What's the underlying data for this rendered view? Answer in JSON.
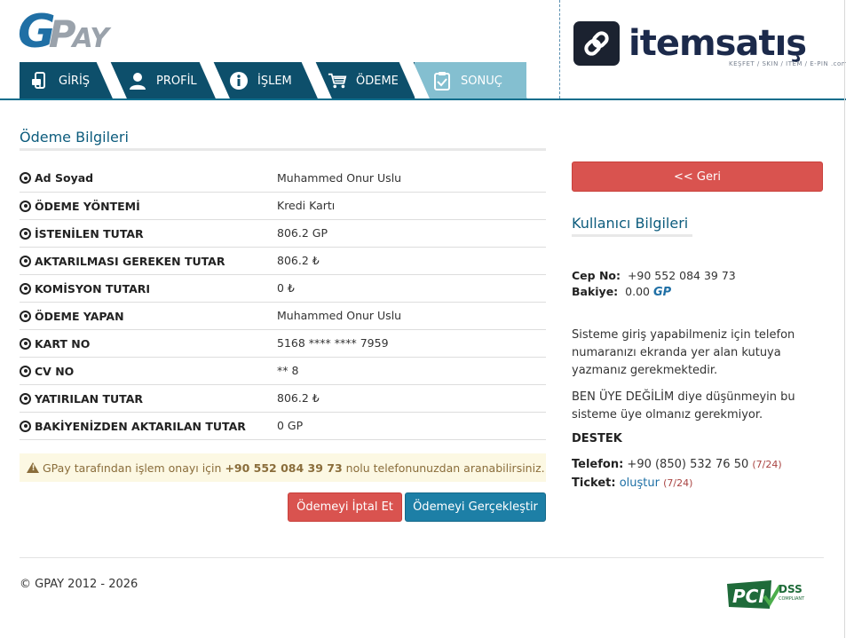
{
  "brand": {
    "logo_text_g": "G",
    "logo_text_p": "P",
    "logo_text_ay": "AY",
    "partner_name": "itemsatış",
    "partner_sub": "KEŞFET / SKIN / ITEM / E-PIN .com"
  },
  "tabs": [
    {
      "label": "GİRİŞ",
      "icon": "phone-card-icon"
    },
    {
      "label": "PROFİL",
      "icon": "user-icon"
    },
    {
      "label": "İŞLEM",
      "icon": "info-icon"
    },
    {
      "label": "ÖDEME",
      "icon": "cart-icon"
    },
    {
      "label": "SONUÇ",
      "icon": "clipboard-check-icon",
      "active": true
    }
  ],
  "payment": {
    "title": "Ödeme Bilgileri",
    "rows": [
      {
        "label": "Ad Soyad",
        "value": "Muhammed Onur Uslu"
      },
      {
        "label": "ÖDEME YÖNTEMİ",
        "value": "Kredi Kartı"
      },
      {
        "label": "İSTENİLEN TUTAR",
        "value": "806.2 GP"
      },
      {
        "label": "AKTARILMASI GEREKEN TUTAR",
        "value": "806.2 ₺"
      },
      {
        "label": "KOMİSYON TUTARI",
        "value": "0 ₺"
      },
      {
        "label": "ÖDEME YAPAN",
        "value": "Muhammed Onur Uslu"
      },
      {
        "label": "KART NO",
        "value": "5168 **** **** 7959"
      },
      {
        "label": "CV NO",
        "value": "** 8"
      },
      {
        "label": "YATIRILAN TUTAR",
        "value": "806.2 ₺"
      },
      {
        "label": "BAKİYENİZDEN AKTARILAN TUTAR",
        "value": "0 GP"
      }
    ],
    "alert_pre": "GPay tarafından işlem onayı için ",
    "alert_phone": "+90 552 084 39 73",
    "alert_post": " nolu telefonunuzdan aranabilirsiniz.",
    "cancel_label": "Ödemeyi İptal Et",
    "confirm_label": "Ödemeyi Gerçekleştir"
  },
  "sidebar": {
    "back_label": "<< Geri",
    "user_title": "Kullanıcı Bilgileri",
    "phone_label": "Cep No:",
    "phone_value": "+90 552 084 39 73",
    "balance_label": "Bakiye:",
    "balance_value": "0.00",
    "balance_unit": "GP",
    "desc1": "Sisteme giriş yapabilmeniz için telefon numaranızı ekranda yer alan kutuya yazmanız gerekmektedir.",
    "desc2": "BEN ÜYE DEĞİLİM diye düşünmeyin bu sisteme üye olmanız gerekmiyor.",
    "support_title": "DESTEK",
    "tel_label": "Telefon:",
    "tel_value": "+90 (850) 532 76 50",
    "tel_hours": "(7/24)",
    "ticket_label": "Ticket:",
    "ticket_link": "oluştur",
    "ticket_hours": "(7/24)"
  },
  "footer": {
    "copyright": "© GPAY 2012 - 2026",
    "pci_text": "PCI",
    "dss_text": "DSS",
    "compliant_text": "COMPLIANT"
  },
  "colors": {
    "primary": "#0d4f6b",
    "active_tab": "#84bfd0",
    "danger": "#d9534f",
    "action": "#1d7fa6",
    "alert_bg": "#fcf8e3"
  }
}
